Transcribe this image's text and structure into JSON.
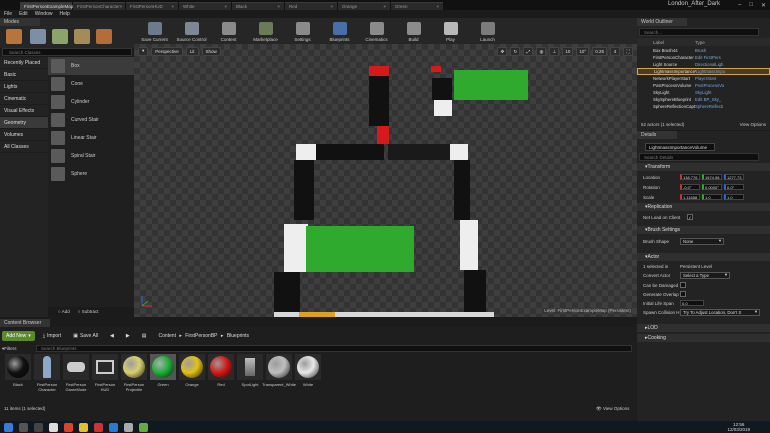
{
  "tabs": [
    "FirstPersonExampleMap",
    "FirstPersonCharacter",
    "FirstPersonHUD",
    "White",
    "Black",
    "Red",
    "Orange",
    "Green"
  ],
  "project_name": "London_After_Dark",
  "menu": [
    "File",
    "Edit",
    "Window",
    "Help"
  ],
  "modes_tab": "Modes",
  "search_classes_placeholder": "Search Classes",
  "categories": [
    "Recently Placed",
    "Basic",
    "Lights",
    "Cinematic",
    "Visual Effects",
    "Geometry",
    "Volumes",
    "All Classes"
  ],
  "selected_category": "Geometry",
  "place_items": [
    "Box",
    "Cone",
    "Cylinder",
    "Curved Stair",
    "Linear Stair",
    "Spiral Stair",
    "Sphere"
  ],
  "add_label": "Add",
  "subtract_label": "Subtract",
  "toolbar": [
    {
      "label": "Save Current",
      "color": "#6b7a8c"
    },
    {
      "label": "Source Control",
      "color": "#7e8894"
    },
    {
      "label": "Content",
      "color": "#8a8a8a"
    },
    {
      "label": "Marketplace",
      "color": "#6a7b5a"
    },
    {
      "label": "Settings",
      "color": "#8a8a8a"
    },
    {
      "label": "Blueprints",
      "color": "#4a6ea8"
    },
    {
      "label": "Cinematics",
      "color": "#8a8a8a"
    },
    {
      "label": "Build",
      "color": "#8c8c8c"
    },
    {
      "label": "Play",
      "color": "#b8b8b8"
    },
    {
      "label": "Launch",
      "color": "#7c7c7c"
    }
  ],
  "viewport": {
    "perspective": "Perspective",
    "lit": "Lit",
    "show": "Show",
    "grid": "10",
    "angle": "10°",
    "scale": "0.25",
    "cam": "4",
    "level_label": "Level: FirstPersonExampleMap (Persistent)"
  },
  "outliner": {
    "tab": "World Outliner",
    "search_placeholder": "Search...",
    "col_label": "Label",
    "col_type": "Type",
    "rows": [
      {
        "name": "Box Brush44",
        "type": "Brush"
      },
      {
        "name": "FirstPersonCharacter",
        "type": "Edit FirstPers"
      },
      {
        "name": "Light Source",
        "type": "DirectionalLigh"
      },
      {
        "name": "LightmassImportanceVolum",
        "type": "LightmassImpo"
      },
      {
        "name": "NetworkPlayerStart",
        "type": "PlayerStart"
      },
      {
        "name": "PostProcessVolume",
        "type": "PostProcessVo"
      },
      {
        "name": "SkyLight",
        "type": "SkyLight"
      },
      {
        "name": "SkySphereBlueprint",
        "type": "Edit BP_Sky_"
      },
      {
        "name": "SphereReflectionCapture",
        "type": "SphereReflecti"
      }
    ],
    "selected_row": 3,
    "status": "52 actors (1 selected)",
    "view_options": "View Options"
  },
  "details": {
    "tab": "Details",
    "object_name": "LightmassImportanceVolume",
    "search_placeholder": "Search Details",
    "transform": "Transform",
    "location_label": "Location",
    "location": [
      "138.776",
      "1674.98",
      "1277.73"
    ],
    "rotation_label": "Rotation",
    "rotation": [
      "-0.0°",
      "0.0000°",
      "0.0°"
    ],
    "scale_label": "Scale",
    "scale": [
      "1.11658",
      "1.0",
      "1.0"
    ],
    "replication": "Replication",
    "net_load": "Net Load on Client",
    "brush_settings": "Brush Settings",
    "brush_shape_label": "Brush Shape",
    "brush_shape": "None",
    "actor": "Actor",
    "selected_in_label": "1 selected in",
    "selected_in": "Persistent Level",
    "convert_actor_label": "Convert Actor",
    "convert_actor": "Select a Type",
    "can_be_damaged": "Can be Damaged",
    "generate_overlap": "Generate Overlap",
    "initial_life_span_label": "Initial Life Span",
    "initial_life_span": "0.0",
    "spawn_collision_label": "Spawn Collision H",
    "spawn_collision": "Try To Adjust Location, Don't S",
    "lod": "LOD",
    "cooking": "Cooking"
  },
  "content_browser": {
    "tab": "Content Browser",
    "add_new": "Add New",
    "import": "Import",
    "save_all": "Save All",
    "path": [
      "Content",
      "FirstPersonBP",
      "Blueprints"
    ],
    "filters": "Filters",
    "search_placeholder": "Search Blueprints",
    "assets": [
      {
        "label": "Black",
        "kind": "ball",
        "color": "#111111"
      },
      {
        "label": "FirstPerson Character",
        "kind": "figure",
        "color": "#8fa8c8"
      },
      {
        "label": "FirstPerson GameMode",
        "kind": "pad",
        "color": "#cccccc"
      },
      {
        "label": "FirstPerson HUD",
        "kind": "hud",
        "color": "#cccccc"
      },
      {
        "label": "FirstPerson Projectile",
        "kind": "ball",
        "color": "#d8d070"
      },
      {
        "label": "Green",
        "kind": "ball",
        "color": "#1fae3a"
      },
      {
        "label": "Orange",
        "kind": "ball",
        "color": "#e0c21a"
      },
      {
        "label": "Red",
        "kind": "ball",
        "color": "#d41a1a"
      },
      {
        "label": "SpotLight",
        "kind": "light",
        "color": "#c0c0c0"
      },
      {
        "label": "Transparent_White",
        "kind": "ball",
        "color": "#bfbfbf"
      },
      {
        "label": "White",
        "kind": "ball",
        "color": "#e8e8e8"
      }
    ],
    "selected_asset": 5,
    "status": "11 items (1 selected)",
    "view_options": "View Options"
  },
  "clock": {
    "time": "12:56",
    "date": "12/03/2019"
  }
}
